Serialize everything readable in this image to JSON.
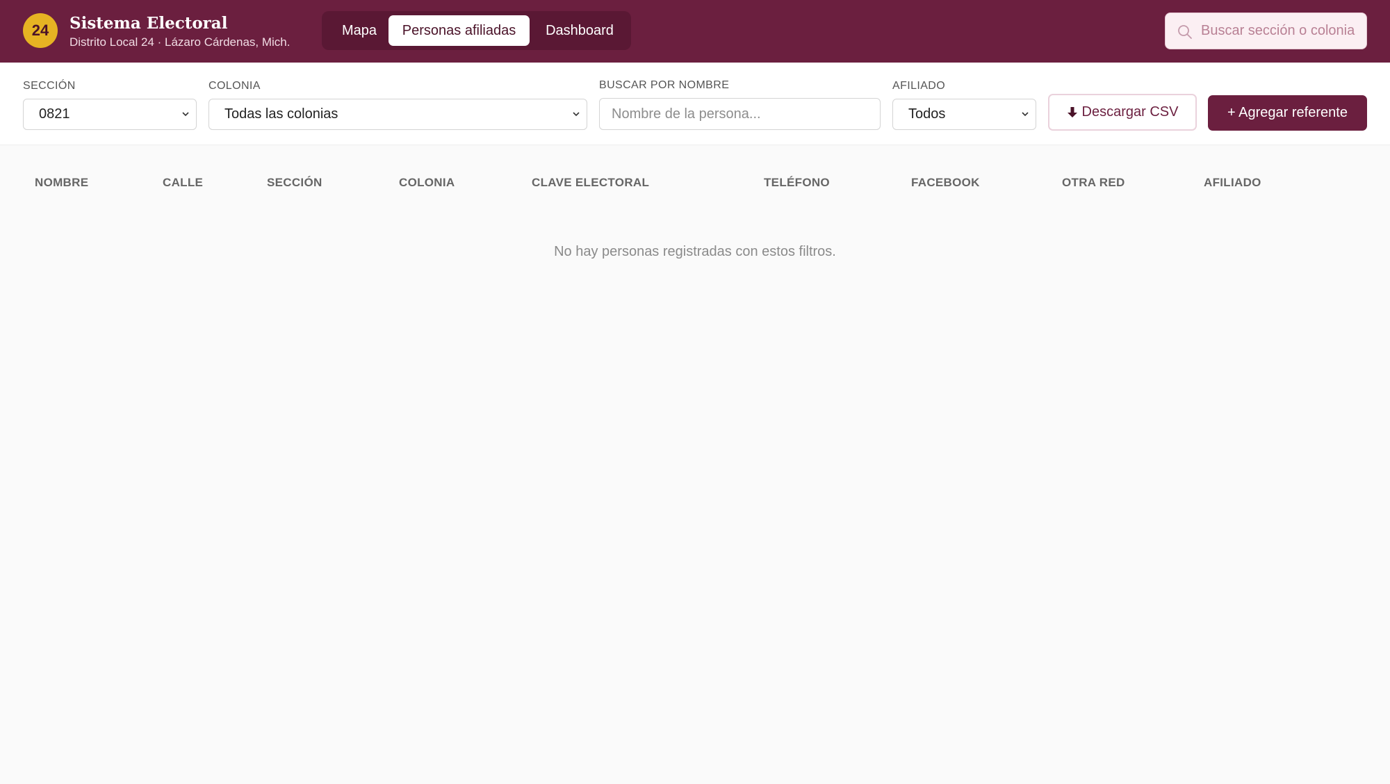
{
  "header": {
    "logo_text": "24",
    "title": "Sistema Electoral",
    "subtitle": "Distrito Local 24 · Lázaro Cárdenas, Mich.",
    "tabs": [
      {
        "label": "Mapa",
        "active": false
      },
      {
        "label": "Personas afiliadas",
        "active": true
      },
      {
        "label": "Dashboard",
        "active": false
      }
    ],
    "search": {
      "placeholder": "Buscar sección o colonia",
      "value": ""
    }
  },
  "filters": {
    "seccion": {
      "label": "SECCIÓN",
      "value": "0821"
    },
    "colonia": {
      "label": "COLONIA",
      "value": "Todas las colonias"
    },
    "nombre": {
      "label": "BUSCAR POR NOMBRE",
      "placeholder": "Nombre de la persona...",
      "value": ""
    },
    "afiliado": {
      "label": "AFILIADO",
      "value": "Todos"
    },
    "download_label": "Descargar CSV",
    "add_label": "+ Agregar referente"
  },
  "table": {
    "columns": [
      "NOMBRE",
      "CALLE",
      "SECCIÓN",
      "COLONIA",
      "CLAVE ELECTORAL",
      "TELÉFONO",
      "FACEBOOK",
      "OTRA RED",
      "AFILIADO"
    ],
    "rows": [],
    "empty_message": "No hay personas registradas con estos filtros."
  },
  "colors": {
    "primary": "#6b1f3f",
    "accent": "#e6b323",
    "background": "#fafafa"
  },
  "icons": {
    "search": "search-icon",
    "download": "download-icon",
    "chevron": "chevron-down-icon"
  }
}
